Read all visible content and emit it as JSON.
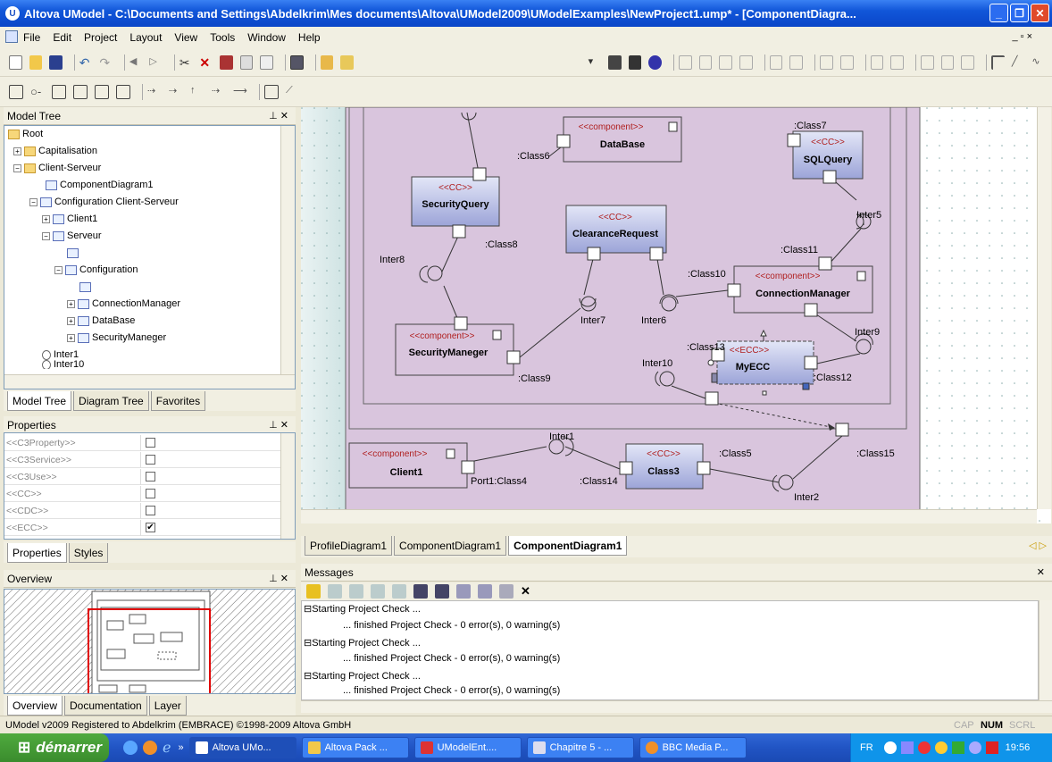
{
  "window": {
    "title": "Altova UModel - C:\\Documents and Settings\\Abdelkrim\\Mes documents\\Altova\\UModel2009\\UModelExamples\\NewProject1.ump* - [ComponentDiagra...",
    "app_icon": "U"
  },
  "menu": [
    "File",
    "Edit",
    "Project",
    "Layout",
    "View",
    "Tools",
    "Window",
    "Help"
  ],
  "mdi_controls": "_ ▫ ×",
  "model_tree": {
    "title": "Model Tree",
    "items": [
      {
        "label": "Root"
      },
      {
        "label": "Capitalisation"
      },
      {
        "label": "Client-Serveur"
      },
      {
        "label": "ComponentDiagram1"
      },
      {
        "label": "Configuration Client-Serveur"
      },
      {
        "label": "Client1"
      },
      {
        "label": "Serveur"
      },
      {
        "label": "Configuration"
      },
      {
        "label": "ConnectionManager"
      },
      {
        "label": "DataBase"
      },
      {
        "label": "SecurityManeger"
      },
      {
        "label": "Inter1"
      },
      {
        "label": "Inter10"
      }
    ],
    "tabs": [
      "Model Tree",
      "Diagram Tree",
      "Favorites"
    ]
  },
  "properties": {
    "title": "Properties",
    "rows": [
      {
        "label": "<<C3Property>>",
        "checked": ""
      },
      {
        "label": "<<C3Service>>",
        "checked": ""
      },
      {
        "label": "<<C3Use>>",
        "checked": ""
      },
      {
        "label": "<<CC>>",
        "checked": ""
      },
      {
        "label": "<<CDC>>",
        "checked": ""
      },
      {
        "label": "<<ECC>>",
        "checked": "✔"
      }
    ],
    "tabs": [
      "Properties",
      "Styles"
    ]
  },
  "overview": {
    "title": "Overview",
    "tabs": [
      "Overview",
      "Documentation",
      "Layer"
    ]
  },
  "diagram": {
    "stereo_component": "<<component>>",
    "stereo_cc": "<<CC>>",
    "stereo_ecc": "<<ECC>>",
    "boxes": {
      "database": "DataBase",
      "sqlquery": "SQLQuery",
      "securityquery": "SecurityQuery",
      "clearance": "ClearanceRequest",
      "connmgr": "ConnectionManager",
      "secmgr": "SecurityManeger",
      "myecc": "MyECC",
      "client1": "Client1",
      "class3": "Class3"
    },
    "labels": {
      "class7": ":Class7",
      "class6": ":Class6",
      "inter5": "Inter5",
      "class11": ":Class11",
      "class8": ":Class8",
      "inter8": "Inter8",
      "class10": ":Class10",
      "inter7": "Inter7",
      "inter6": "Inter6",
      "inter9": "Inter9",
      "class13": ":Class13",
      "inter10": "Inter10",
      "class9": ":Class9",
      "class12": ":Class12",
      "inter1": "Inter1",
      "class5": ":Class5",
      "class15": ":Class15",
      "port1": "Port1:Class4",
      "class14": ":Class14",
      "inter2": "Inter2"
    }
  },
  "doc_tabs": [
    "ProfileDiagram1",
    "ComponentDiagram1",
    "ComponentDiagram1"
  ],
  "messages": {
    "title": "Messages",
    "lines": [
      "Starting Project Check ...",
      "... finished Project Check - 0 error(s), 0 warning(s)",
      "Starting Project Check ...",
      "... finished Project Check - 0 error(s), 0 warning(s)",
      "Starting Project Check ...",
      "... finished Project Check - 0 error(s), 0 warning(s)"
    ]
  },
  "status": {
    "text": "UModel v2009   Registered to Abdelkrim (EMBRACE)   ©1998-2009 Altova GmbH",
    "cap": "CAP",
    "num": "NUM",
    "scrl": "SCRL"
  },
  "taskbar": {
    "start": "démarrer",
    "tasks": [
      "Altova UMo...",
      "Altova Pack ...",
      "UModelEnt....",
      "Chapitre 5 - ...",
      "BBC Media P..."
    ],
    "lang": "FR",
    "clock": "19:56"
  },
  "colors": {
    "diagram_bg": "#d9c5dd",
    "cc_box": "#bcc3e8",
    "title_blue": "#0a46c8",
    "task_blue": "#3c81f3"
  }
}
